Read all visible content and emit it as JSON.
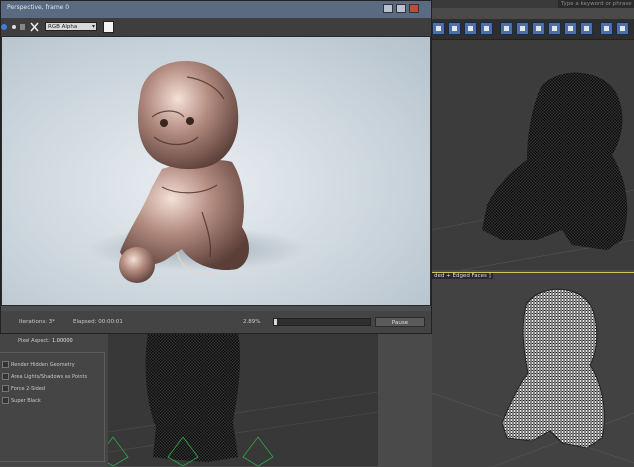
{
  "app": {
    "search_placeholder": "Type a keyword or phrase"
  },
  "render_window": {
    "title": "Perspective, frame 0",
    "channel_select": "RGB Alpha",
    "status": {
      "iterations": "Iterations: 3*",
      "elapsed": "Elapsed: 00:00:01",
      "percent": "2.89%",
      "progress_fraction": 0.0289,
      "pause_label": "Pause"
    }
  },
  "rollout": {
    "pixel_aspect_label": "Pixel Aspect:",
    "pixel_aspect_value": "1.00000",
    "options": [
      "Render Hidden Geometry",
      "Area Lights/Shadows as Points",
      "Force 2-Sided",
      "Super Black"
    ]
  },
  "viewports": {
    "lower_right_label": "ded + Edged Faces ]"
  },
  "colors": {
    "toolbar_icon": "#4b6fa8",
    "selected_viewport_border": "#d8c25a",
    "statue": "#b38b7f"
  }
}
